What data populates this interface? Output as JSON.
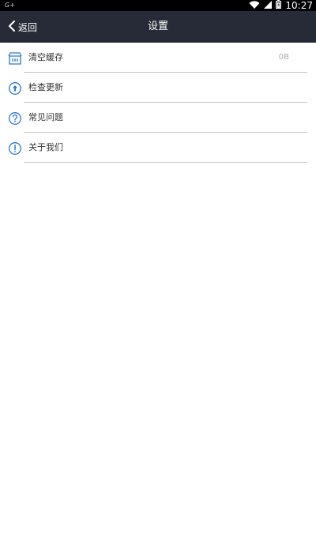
{
  "status_bar": {
    "left_text": "G+",
    "time": "10:27"
  },
  "nav": {
    "back_label": "返回",
    "title": "设置"
  },
  "settings": {
    "items": [
      {
        "label": "清空缓存",
        "value": "0B",
        "icon": "clear-cache-icon"
      },
      {
        "label": "检查更新",
        "value": "",
        "icon": "update-icon"
      },
      {
        "label": "常见问题",
        "value": "",
        "icon": "faq-icon"
      },
      {
        "label": "关于我们",
        "value": "",
        "icon": "about-icon"
      }
    ]
  },
  "colors": {
    "nav_background": "#272b37",
    "accent": "#2a77c9"
  }
}
